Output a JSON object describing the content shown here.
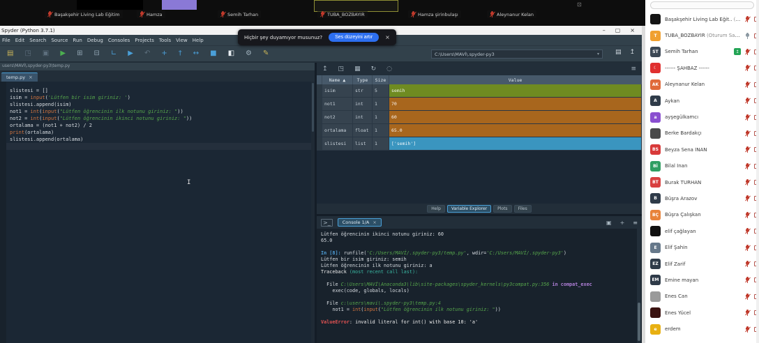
{
  "meeting": {
    "tiles": [
      {
        "name": "Başakşehir Living Lab Eğitim"
      },
      {
        "name": "Hamza"
      },
      {
        "name": "Semih Tarhan"
      },
      {
        "name": "TUBA_BOZBAYIR",
        "active": true
      },
      {
        "name": "Hamza şirinbulaşı"
      },
      {
        "name": "Aleynanur Kelan"
      }
    ]
  },
  "toast": {
    "message": "Hiçbir şey duyamıyor musunuz?",
    "button_label": "Ses düzeyini artır",
    "close_glyph": "×"
  },
  "spyder": {
    "title": "Spyder (Python 3.7.1)",
    "window_controls": {
      "minimize": "–",
      "maximize": "▢",
      "close": "×"
    },
    "menu": [
      "File",
      "Edit",
      "Search",
      "Source",
      "Run",
      "Debug",
      "Consoles",
      "Projects",
      "Tools",
      "View",
      "Help"
    ],
    "toolbar": {
      "icons": [
        {
          "name": "open-file-icon",
          "glyph": "▤",
          "color": "#c9b458"
        },
        {
          "name": "save-icon",
          "glyph": "◳",
          "color": "#5d6f7d"
        },
        {
          "name": "save-all-icon",
          "glyph": "▣",
          "color": "#5d6f7d"
        },
        {
          "name": "run-icon",
          "glyph": "▶",
          "color": "#4caf50"
        },
        {
          "name": "run-cell-icon",
          "glyph": "⊞",
          "color": "#8fa3b0"
        },
        {
          "name": "run-cell-advance-icon",
          "glyph": "⊟",
          "color": "#8fa3b0"
        },
        {
          "name": "run-selection-icon",
          "glyph": "∟",
          "color": "#4a9fd8"
        },
        {
          "name": "rerun-cell-icon",
          "glyph": "▶",
          "color": "#4a9fd8"
        },
        {
          "name": "undo-icon",
          "glyph": "↶",
          "color": "#5d6f7d"
        },
        {
          "name": "step-into-icon",
          "glyph": "+",
          "color": "#4a9fd8"
        },
        {
          "name": "step-over-icon",
          "glyph": "†",
          "color": "#4a9fd8"
        },
        {
          "name": "continue-icon",
          "glyph": "↔",
          "color": "#4a9fd8"
        },
        {
          "name": "stop-debug-icon",
          "glyph": "■",
          "color": "#4a9fd8"
        },
        {
          "name": "maximize-pane-icon",
          "glyph": "◧",
          "color": "#e8eef2"
        },
        {
          "name": "tools-icon",
          "glyph": "⚙",
          "color": "#9fb0bc"
        },
        {
          "name": "edit-icon",
          "glyph": "✎",
          "color": "#c9b458"
        }
      ],
      "path_value": "C:\\Users\\MAVİ\\.spyder-py3",
      "dropdown_glyph": "▾",
      "folder_glyph": "▤",
      "up_glyph": "↥"
    },
    "editor": {
      "path": "users\\MAVİ\\.spyder-py3\\temp.py",
      "tab_label": "temp.py",
      "tab_close_glyph": "×",
      "code_lines": [
        [
          {
            "t": "slistesi = []",
            "c": "p"
          }
        ],
        [
          {
            "t": "isim = ",
            "c": "p"
          },
          {
            "t": "input",
            "c": "b"
          },
          {
            "t": "(",
            "c": "p"
          },
          {
            "t": "'Lütfen bir isim giriniz: '",
            "c": "s"
          },
          {
            "t": ")",
            "c": "p"
          }
        ],
        [
          {
            "t": "slistesi.append(isim)",
            "c": "p"
          }
        ],
        [
          {
            "t": "not1 = ",
            "c": "p"
          },
          {
            "t": "int",
            "c": "b"
          },
          {
            "t": "(",
            "c": "p"
          },
          {
            "t": "input",
            "c": "b"
          },
          {
            "t": "(",
            "c": "p"
          },
          {
            "t": "\"Lütfen öğrencinin ilk notunu giriniz: \"",
            "c": "s"
          },
          {
            "t": "))",
            "c": "p"
          }
        ],
        [
          {
            "t": "not2 = ",
            "c": "p"
          },
          {
            "t": "int",
            "c": "b"
          },
          {
            "t": "(",
            "c": "p"
          },
          {
            "t": "input",
            "c": "b"
          },
          {
            "t": "(",
            "c": "p"
          },
          {
            "t": "\"Lütfen öğrencinin ikinci notunu giriniz: \"",
            "c": "s"
          },
          {
            "t": "))",
            "c": "p"
          }
        ],
        [
          {
            "t": "ortalama = (not1 + not2) / 2",
            "c": "p"
          }
        ],
        [
          {
            "t": "print",
            "c": "b"
          },
          {
            "t": "(ortalama)",
            "c": "p"
          }
        ],
        [
          {
            "t": "slistesi.append(ortalama)",
            "c": "p"
          }
        ]
      ]
    },
    "variable_explorer": {
      "toolbar_icons": [
        {
          "name": "import-data-icon",
          "glyph": "↥"
        },
        {
          "name": "save-data-icon",
          "glyph": "◳"
        },
        {
          "name": "save-data-as-icon",
          "glyph": "▦"
        },
        {
          "name": "refresh-icon",
          "glyph": "↻"
        },
        {
          "name": "search-icon",
          "glyph": "◌"
        }
      ],
      "options_glyph": "≡",
      "columns": [
        "",
        "Name ▲",
        "Type",
        "Size",
        "Value"
      ],
      "rows": [
        {
          "name": "isim",
          "type": "str",
          "size": "5",
          "value": "semih",
          "color": "#6f8b21"
        },
        {
          "name": "not1",
          "type": "int",
          "size": "1",
          "value": "70",
          "color": "#a8661d"
        },
        {
          "name": "not2",
          "type": "int",
          "size": "1",
          "value": "60",
          "color": "#a8661d"
        },
        {
          "name": "ortalama",
          "type": "float",
          "size": "1",
          "value": "65.0",
          "color": "#a8661d"
        },
        {
          "name": "slistesi",
          "type": "list",
          "size": "1",
          "value": "['semih']",
          "color": "#3a95bf"
        }
      ],
      "tabs": [
        "Help",
        "Variable Explorer",
        "Plots",
        "Files"
      ],
      "active_tab": "Variable Explorer"
    },
    "console": {
      "tab_label": "Console 1/A",
      "tab_close_glyph": "×",
      "window_icon_glyph": ">_",
      "right_icons": [
        {
          "name": "clipboard-icon",
          "glyph": "▣"
        },
        {
          "name": "new-console-icon",
          "glyph": "+"
        },
        {
          "name": "options-icon",
          "glyph": "≡"
        }
      ],
      "lines": [
        [
          {
            "t": "Lütfen öğrencinin ikinci notunu giriniz: 60",
            "c": "p"
          }
        ],
        [
          {
            "t": "65.0",
            "c": "p"
          }
        ],
        [],
        [
          {
            "t": "In [8]: ",
            "c": "prompt"
          },
          {
            "t": "runfile(",
            "c": "p"
          },
          {
            "t": "'C:/Users/MAVİ/.spyder-py3/temp.py'",
            "c": "s"
          },
          {
            "t": ", wdir=",
            "c": "p"
          },
          {
            "t": "'C:/Users/MAVİ/.spyder-py3'",
            "c": "s"
          },
          {
            "t": ")",
            "c": "p"
          }
        ],
        [
          {
            "t": "Lütfen bir isim giriniz: semih",
            "c": "p"
          }
        ],
        [
          {
            "t": "Lütfen öğrencinin ilk notunu giriniz: a",
            "c": "p"
          }
        ],
        [
          {
            "t": "Traceback ",
            "c": "w"
          },
          {
            "t": "(most recent call last):",
            "c": "teal"
          }
        ],
        [],
        [
          {
            "t": "  File ",
            "c": "p"
          },
          {
            "t": "C:\\Users\\MAVİ\\Anaconda3\\lib\\site-packages\\spyder_kernels\\py3compat.py:356",
            "c": "s"
          },
          {
            "t": " in ",
            "c": "purple"
          },
          {
            "t": "compat_exec",
            "c": "purple"
          }
        ],
        [
          {
            "t": "    exec(code, globals, locals)",
            "c": "p"
          }
        ],
        [],
        [
          {
            "t": "  File ",
            "c": "p"
          },
          {
            "t": "c:\\users\\mavi\\.spyder-py3\\temp.py:4",
            "c": "s"
          }
        ],
        [
          {
            "t": "    not1 = ",
            "c": "p"
          },
          {
            "t": "int",
            "c": "b"
          },
          {
            "t": "(",
            "c": "p"
          },
          {
            "t": "input",
            "c": "b"
          },
          {
            "t": "(",
            "c": "p"
          },
          {
            "t": "\"Lütfen öğrencinin ilk notunu giriniz: \"",
            "c": "s"
          },
          {
            "t": "))",
            "c": "p"
          }
        ],
        [],
        [
          {
            "t": "ValueError",
            "c": "err"
          },
          {
            "t": ": invalid literal for int() with base 10: 'a'",
            "c": "w"
          }
        ]
      ]
    }
  },
  "participants": {
    "items": [
      {
        "initials": "",
        "name": "Başakşehir Living Lab Eğit..",
        "suffix": "(Ben)",
        "color": "#151515",
        "mic": "muted"
      },
      {
        "initials": "T",
        "name": "TUBA_BOZBAYIR",
        "suffix": "(Oturum Sahibi)",
        "color": "#f0a030",
        "mic": "unmuted"
      },
      {
        "initials": "ST",
        "name": "Semih Tarhan",
        "color": "#3b4754",
        "badge": "screen-share",
        "mic": "muted"
      },
      {
        "initials": "☾",
        "name": "------ ŞAHBAZ ------",
        "color": "#e03030",
        "mic": "muted"
      },
      {
        "initials": "AK",
        "name": "Aleynanur Kelan",
        "color": "#e06a3a",
        "mic": "muted"
      },
      {
        "initials": "A",
        "name": "Aykan",
        "color": "#2f3b49",
        "mic": "muted"
      },
      {
        "initials": "a",
        "name": "ayşegülkamcı",
        "color": "#8a4fd0",
        "mic": "muted"
      },
      {
        "initials": "",
        "name": "Berke Bardakçı",
        "color": "#4a4a4a",
        "photo": true,
        "mic": "muted"
      },
      {
        "initials": "BS",
        "name": "Beyza Sena İNAN",
        "color": "#d83a3a",
        "mic": "muted"
      },
      {
        "initials": "Bİ",
        "name": "Bilal İnan",
        "color": "#2f9e62",
        "mic": "muted"
      },
      {
        "initials": "BT",
        "name": "Burak TURHAN",
        "color": "#d84040",
        "mic": "muted"
      },
      {
        "initials": "B",
        "name": "Büşra Arazov",
        "color": "#2f3b49",
        "mic": "muted"
      },
      {
        "initials": "BÇ",
        "name": "Büşra Çalışkan",
        "color": "#e8833a",
        "mic": "muted"
      },
      {
        "initials": "",
        "name": "elif çağlayan",
        "color": "#101010",
        "mic": "muted"
      },
      {
        "initials": "E",
        "name": "Elif Şahin",
        "color": "#66788a",
        "mic": "muted"
      },
      {
        "initials": "EZ",
        "name": "Elif Zarif",
        "color": "#2f3b49",
        "mic": "muted"
      },
      {
        "initials": "EM",
        "name": "Emine mayan",
        "color": "#2f3b49",
        "mic": "muted"
      },
      {
        "initials": "",
        "name": "Enes Can",
        "color": "#9a9a9a",
        "photo": true,
        "mic": "muted"
      },
      {
        "initials": "",
        "name": "Enes Yücel",
        "color": "#3a1210",
        "photo": true,
        "mic": "muted"
      },
      {
        "initials": "e",
        "name": "erdem",
        "color": "#e8b012",
        "mic": "muted"
      }
    ]
  }
}
